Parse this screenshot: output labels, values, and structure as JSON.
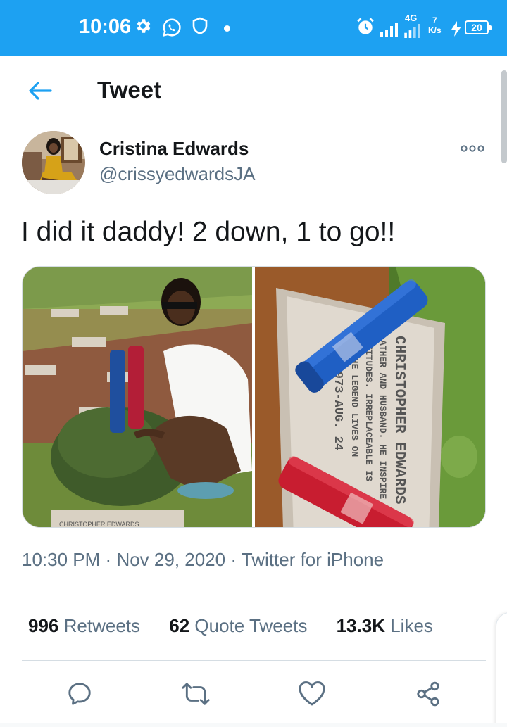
{
  "status_bar": {
    "time": "10:06",
    "network_type": "4G",
    "speed_value": "7",
    "speed_unit": "K/s",
    "battery": "20",
    "icons": [
      "gear-icon",
      "whatsapp-icon",
      "shield-icon",
      "alarm-icon",
      "signal-icon",
      "charging-icon"
    ],
    "background_color": "#1da1f2"
  },
  "header": {
    "title": "Tweet",
    "back_icon": "arrow-left-icon"
  },
  "tweet": {
    "author_name": "Cristina Edwards",
    "author_handle": "@crissyedwardsJA",
    "text": "I did it daddy! 2 down, 1 to go!!",
    "photo_count": 2,
    "photo_text": {
      "left_plaque": "CHRISTOPHER EDWARDS",
      "right_plaque_lines": [
        "CHRISTOPHER EDWARDS",
        "ATHER AND HUSBAND. HE INSPIRE",
        "TITUDES. IRREPLACEABLE IS",
        "THE LEGEND LIVES ON",
        "8, 1973-AUG. 24"
      ]
    },
    "time": "10:30 PM",
    "separator": "·",
    "date": "Nov 29, 2020",
    "source": "Twitter for iPhone"
  },
  "stats": {
    "retweets_count": "996",
    "retweets_label": "Retweets",
    "quotes_count": "62",
    "quotes_label": "Quote Tweets",
    "likes_count": "13.3K",
    "likes_label": "Likes"
  },
  "actions": [
    "reply-icon",
    "retweet-icon",
    "like-icon",
    "share-icon"
  ],
  "colors": {
    "accent": "#1da1f2",
    "text_primary": "#14171a",
    "text_secondary": "#5b7083",
    "divider": "#d5dde3"
  }
}
